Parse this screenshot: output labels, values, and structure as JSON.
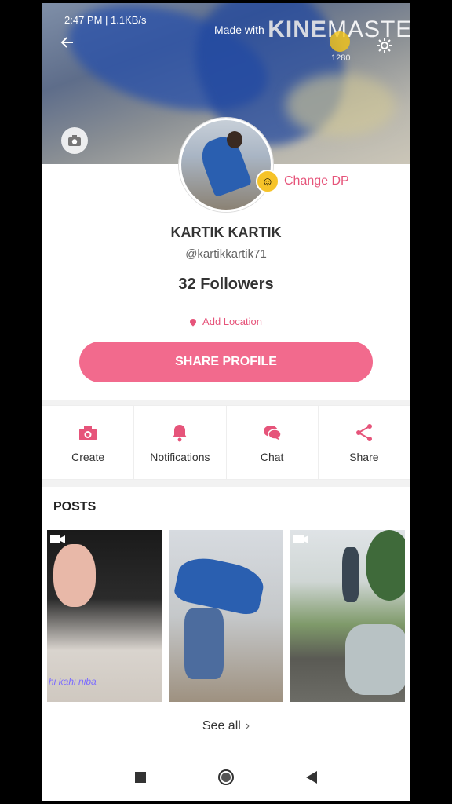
{
  "status_bar": {
    "time_speed": "2:47 PM | 1.1KB/s"
  },
  "watermark": {
    "made_with": "Made with",
    "brand_bold": "KINE",
    "brand_rest": "MASTER"
  },
  "header": {
    "count_label": "1280"
  },
  "profile": {
    "change_dp_label": "Change DP",
    "name": "KARTIK KARTIK",
    "handle": "@kartikkartik71",
    "followers": "32 Followers",
    "add_location": "Add Location",
    "share_profile": "SHARE PROFILE"
  },
  "actions": [
    {
      "label": "Create",
      "icon": "camera-icon"
    },
    {
      "label": "Notifications",
      "icon": "bell-icon"
    },
    {
      "label": "Chat",
      "icon": "chat-icon"
    },
    {
      "label": "Share",
      "icon": "share-icon"
    }
  ],
  "posts": {
    "title": "POSTS",
    "thumb_caption": "hi kahi   niba",
    "see_all": "See all",
    "see_all_chevron": "›"
  },
  "colors": {
    "accent": "#e6547a",
    "button": "#f26a8d"
  }
}
